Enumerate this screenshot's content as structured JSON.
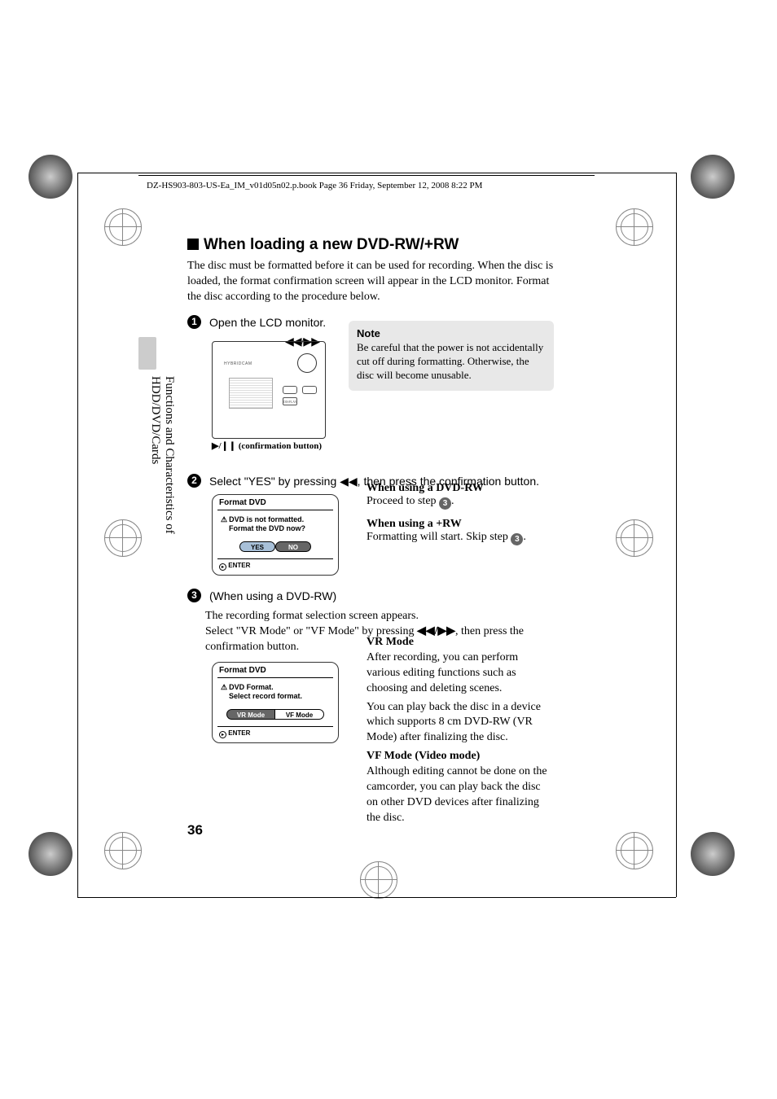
{
  "header": "DZ-HS903-803-US-Ea_IM_v01d05n02.p.book  Page 36  Friday, September 12, 2008  8:22 PM",
  "h1": "When loading a new DVD-RW/+RW",
  "intro": "The disc must be formatted before it can be used for recording. When the disc is loaded, the format confirmation screen will appear in the LCD monitor. Format the disc according to the procedure below.",
  "step1": "Open the LCD monitor.",
  "device_brand": "HYBRIDCAM",
  "device_display_label": "DISPLAY",
  "confirm_caption": " (confirmation button)",
  "confirm_symbol": "▶/❙❙",
  "dpad_row": "◀◀/▶▶",
  "note_title": "Note",
  "note_body": "Be careful that the power is not accidentally cut off during formatting. Otherwise, the disc will become unusable.",
  "step2": "Select \"YES\" by pressing ◀◀, then press the confirmation button.",
  "dialog1": {
    "title": "Format DVD",
    "line1": "DVD is not formatted.",
    "line2": "Format the DVD now?",
    "yes": "YES",
    "no": "NO",
    "enter": "ENTER"
  },
  "s2r": {
    "t1": "When using a DVD-RW",
    "p1a": "Proceed to step ",
    "p1b": ".",
    "t2": "When using a +RW",
    "p2a": "Formatting will start. Skip step ",
    "p2b": "."
  },
  "step3_label": "(When using a DVD-RW)",
  "step3_p1": "The recording format selection screen appears.",
  "step3_p2a": "Select \"VR Mode\" or \"VF Mode\" by pressing ",
  "step3_arrows": "◀◀/▶▶",
  "step3_p2b": ", then press the confirmation button.",
  "dialog2": {
    "title": "Format DVD",
    "line1": "DVD Format.",
    "line2": "Select record format.",
    "vr": "VR Mode",
    "vf": "VF Mode",
    "enter": "ENTER"
  },
  "modes": {
    "vr_title": "VR Mode",
    "vr_p1": "After recording, you can perform various editing functions such as choosing and deleting scenes.",
    "vr_p2": "You can play back the disc in a device which supports 8 cm DVD-RW (VR Mode) after finalizing the disc.",
    "vf_title": "VF Mode (Video mode)",
    "vf_p": "Although editing cannot be done on the camcorder, you can play back the disc on other DVD devices after finalizing the disc."
  },
  "side_label": "Functions and Characteristics of HDD/DVD/Cards",
  "page_num": "36"
}
